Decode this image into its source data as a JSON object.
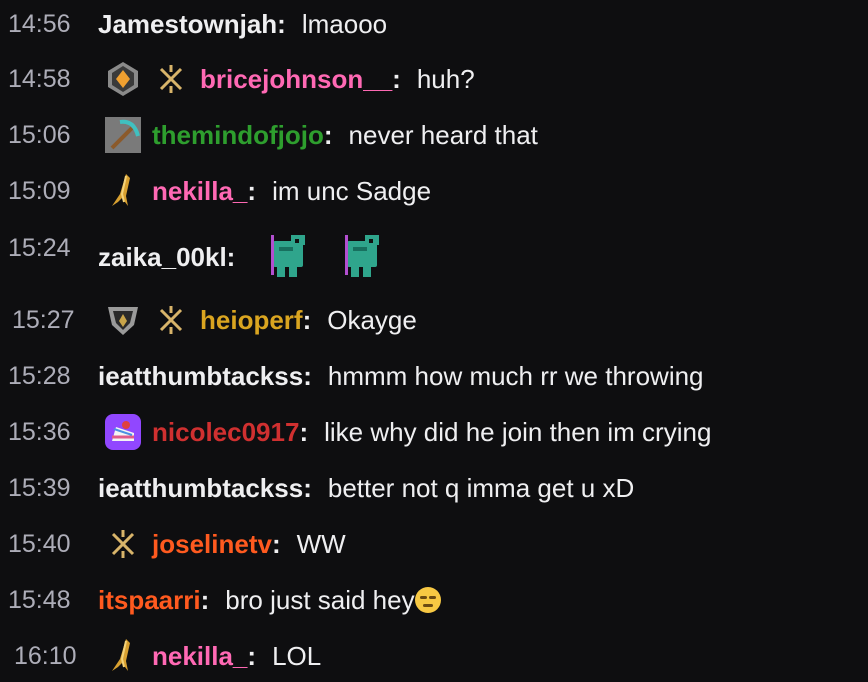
{
  "messages": [
    {
      "time": "14:56",
      "user": "Jamestownjah",
      "color": "#efeff1",
      "badges": [],
      "text": "lmaooo"
    },
    {
      "time": "14:58",
      "user": "bricejohnson__",
      "color": "#ff69b4",
      "badges": [
        "rank-badge-icon",
        "valorant-logo-icon"
      ],
      "text": "huh?"
    },
    {
      "time": "15:06",
      "user": "themindofjojo",
      "color": "#2e9e2e",
      "badges": [
        "pickaxe-icon"
      ],
      "text": "never heard that"
    },
    {
      "time": "15:09",
      "user": "nekilla_",
      "color": "#ff69b4",
      "badges": [
        "gold-sword-icon"
      ],
      "text": "im unc Sadge"
    },
    {
      "time": "15:24",
      "user": "zaika_00kl",
      "color": "#efeff1",
      "badges": [],
      "text": "",
      "emotes": [
        "dinosaur-emote",
        "dinosaur-emote"
      ]
    },
    {
      "time": "15:27",
      "user": "heioperf",
      "color": "#daa520",
      "badges": [
        "silver-rank-icon",
        "valorant-logo-icon"
      ],
      "text": "Okayge"
    },
    {
      "time": "15:28",
      "user": "ieatthumbtackss",
      "color": "#efeff1",
      "badges": [],
      "text": "hmmm how much rr we throwing"
    },
    {
      "time": "15:36",
      "user": "nicolec0917",
      "color": "#d03030",
      "badges": [
        "cake-icon"
      ],
      "text": "like why did he join then im crying"
    },
    {
      "time": "15:39",
      "user": "ieatthumbtackss",
      "color": "#efeff1",
      "badges": [],
      "text": "better not q imma get u xD"
    },
    {
      "time": "15:40",
      "user": "joselinetv",
      "color": "#ff5a1f",
      "badges": [
        "valorant-logo-icon"
      ],
      "text": "WW"
    },
    {
      "time": "15:48",
      "user": "itspaarri",
      "color": "#ff5a1f",
      "badges": [],
      "text": "bro just said hey",
      "emoji": "smirk-emoji"
    },
    {
      "time": "16:10",
      "user": "nekilla_",
      "color": "#ff69b4",
      "badges": [
        "gold-sword-icon"
      ],
      "text": "LOL"
    }
  ]
}
